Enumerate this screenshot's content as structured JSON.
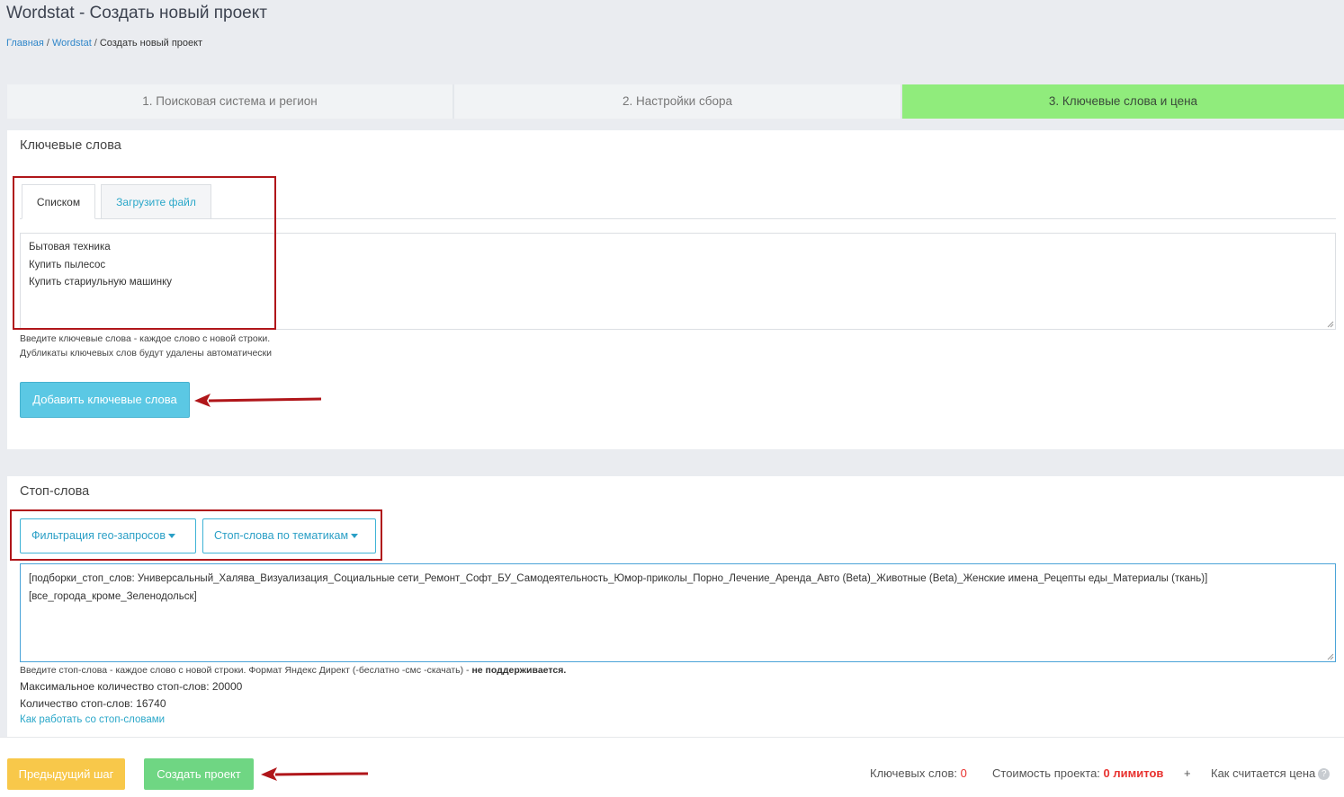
{
  "page": {
    "title": "Wordstat - Создать новый проект",
    "breadcrumb": [
      "Главная",
      "Wordstat",
      "Создать новый проект"
    ],
    "breadcrumb_separator": "/"
  },
  "steps": [
    {
      "label": "1. Поисковая система и регион",
      "active": false
    },
    {
      "label": "2. Настройки сбора",
      "active": false
    },
    {
      "label": "3. Ключевые слова и цена",
      "active": true
    }
  ],
  "keywords": {
    "title": "Ключевые слова",
    "tabs": [
      "Списком",
      "Загрузите файл"
    ],
    "lines": [
      "Бытовая техника",
      "Купить пылесос",
      "Купить стариульную машинку"
    ],
    "help_line1": "Введите ключевые слова - каждое слово с новой строки.",
    "help_line2": "Дубликаты ключевых слов будут удалены автоматически",
    "add_button": "Добавить ключевые слова"
  },
  "stopwords": {
    "title": "Стоп-слова",
    "geo_button": "Фильтрация гео-запросов",
    "topics_button": "Стоп-слова по тематикам",
    "lines": [
      "[подборки_стоп_слов: Универсальный_Халява_Визуализация_Социальные сети_Ремонт_Софт_БУ_Самодеятельность_Юмор-приколы_Порно_Лечение_Аренда_Авто (Beta)_Животные (Beta)_Женские имена_Рецепты еды_Материалы (ткань)]",
      "[все_города_кроме_Зеленодольск]"
    ],
    "help_text": "Введите стоп-слова - каждое слово с новой строки. Формат Яндекс Директ (-беслатно -смс -скачать) -",
    "help_bold": "не поддерживается.",
    "max_label": "Максимальное количество стоп-слов: 20000",
    "count_label": "Количество стоп-слов: 16740",
    "howto_link": "Как работать со стоп-словами"
  },
  "footer": {
    "prev_button": "Предыдущий шаг",
    "create_button": "Создать проект",
    "keywords_label": "Ключевых слов:",
    "keywords_count": "0",
    "cost_label": "Стоимость проекта:",
    "cost_value": "0 лимитов",
    "plus_sign": "+",
    "price_info": "Как считается цена",
    "help_icon": "?"
  },
  "colors": {
    "active_step": "#90ec7c",
    "add_button": "#5bc8e4",
    "prev_button": "#f8c84a",
    "create_button": "#6fd683",
    "annotation": "#b0161a"
  }
}
